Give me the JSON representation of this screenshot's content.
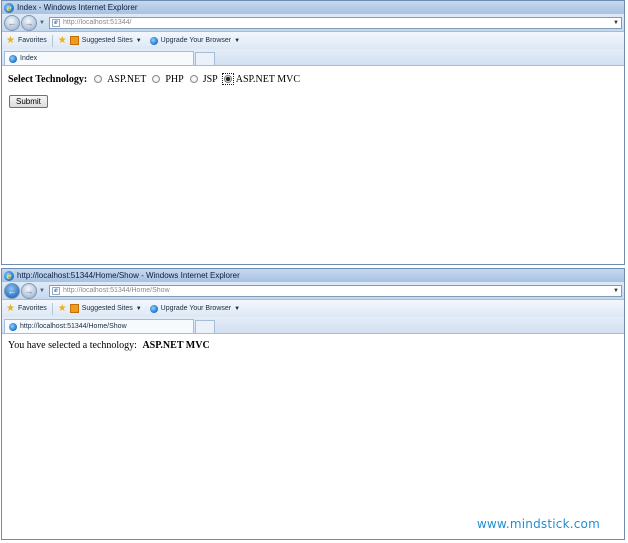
{
  "window1": {
    "title": "Index - Windows Internet Explorer",
    "address": "http://localhost:51344/",
    "favorites_label": "Favorites",
    "suggested_sites_label": "Suggested Sites",
    "upgrade_label": "Upgrade Your Browser",
    "tab_label": "Index",
    "form": {
      "label": "Select Technology:",
      "options": [
        "ASP.NET",
        "PHP",
        "JSP",
        "ASP.NET MVC"
      ],
      "selected": "ASP.NET MVC",
      "submit_label": "Submit"
    }
  },
  "window2": {
    "title": "http://localhost:51344/Home/Show - Windows Internet Explorer",
    "address": "http://localhost:51344/Home/Show",
    "favorites_label": "Favorites",
    "suggested_sites_label": "Suggested Sites",
    "upgrade_label": "Upgrade Your Browser",
    "tab_label": "http://localhost:51344/Home/Show",
    "result_prefix": "You have selected a technology:",
    "result_value": "ASP.NET MVC"
  },
  "watermark": "www.mindstick.com",
  "colors": {
    "titlebar": "#a7c2e2",
    "watermark": "#1f8ed6"
  },
  "icons": [
    "ie-logo-icon",
    "back-icon",
    "forward-icon",
    "page-icon",
    "star-icon",
    "add-favorite-icon",
    "suggested-sites-icon"
  ]
}
